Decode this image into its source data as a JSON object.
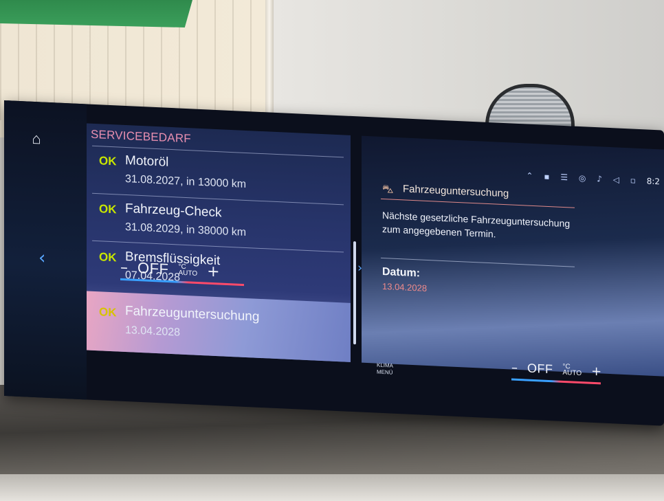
{
  "list": {
    "title": "SERVICEBEDARF",
    "items": [
      {
        "status": "OK",
        "name": "Motoröl",
        "detail": "31.08.2027, in 13000 km"
      },
      {
        "status": "OK",
        "name": "Fahrzeug-Check",
        "detail": "31.08.2029, in 38000 km"
      },
      {
        "status": "OK",
        "name": "Bremsflüssigkeit",
        "detail": "07.04.2028"
      },
      {
        "status": "OK",
        "name": "Fahrzeuguntersuchung",
        "detail": "13.04.2028",
        "selected": true
      }
    ]
  },
  "detail": {
    "title": "Fahrzeuguntersuchung",
    "description": "Nächste gesetzliche Fahrzeuguntersuchung zum angegebenen Termin.",
    "label": "Datum:",
    "value": "13.04.2028"
  },
  "status_bar": {
    "time": "8:2"
  },
  "climate": {
    "left": {
      "minus": "–",
      "state": "OFF",
      "unit_top": "°C",
      "unit_bottom": "AUTO",
      "plus": "+"
    },
    "right": {
      "minus": "–",
      "state": "OFF",
      "unit_top": "°C",
      "unit_bottom": "AUTO",
      "plus": "+"
    },
    "menu_line1": "KLIMA",
    "menu_line2": "MENÜ"
  },
  "icons": {
    "home": "home-icon",
    "nav_left": "chevron-left-icon",
    "nav_right": "chevron-right-icon",
    "inspection": "car-inspection-icon"
  },
  "colors": {
    "accent_pink": "#e98fb0",
    "ok_green": "#c8e600",
    "nav_blue": "#59a7ff",
    "date_red": "#f08a8a"
  }
}
